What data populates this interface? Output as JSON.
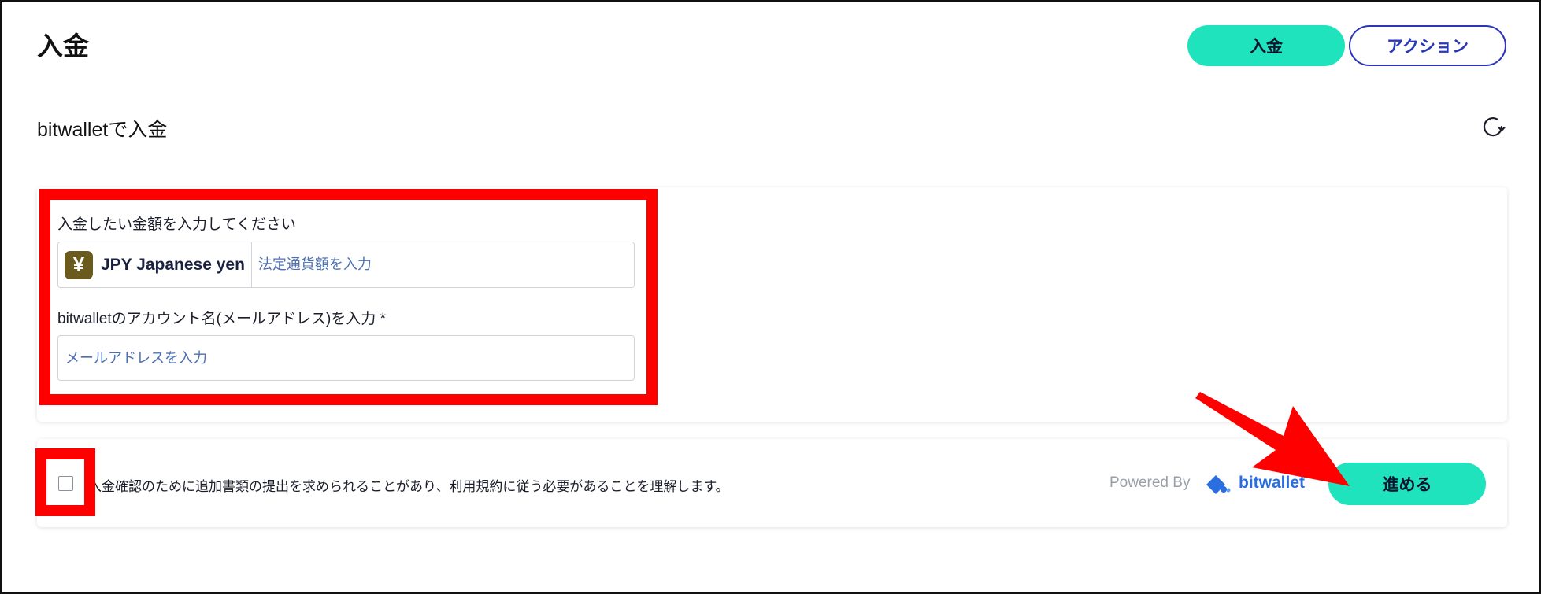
{
  "header": {
    "title": "入金",
    "deposit_label": "入金",
    "action_label": "アクション"
  },
  "section": {
    "title": "bitwalletで入金"
  },
  "form": {
    "amount_label": "入金したい金額を入力してください",
    "currency_symbol": "¥",
    "currency_name": "JPY Japanese yen",
    "amount_placeholder": "法定通貨額を入力",
    "email_label": "bitwalletのアカウント名(メールアドレス)を入力 *",
    "email_placeholder": "メールアドレスを入力"
  },
  "confirm": {
    "terms_text": "入金確認のために追加書類の提出を求められることがあり、利用規約に従う必要があることを理解します。",
    "powered_by": "Powered By",
    "provider": "bitwallet",
    "proceed_label": "進める"
  },
  "colors": {
    "accent": "#1fe3bd",
    "action_border": "#2a37b8",
    "highlight": "#ff0000",
    "link_placeholder": "#4d6fb3",
    "bitwallet_blue": "#2a6ee0"
  },
  "icons": {
    "refresh": "refresh-icon",
    "yen": "yen-icon",
    "bitwallet_logo": "bitwallet-logo-icon"
  }
}
